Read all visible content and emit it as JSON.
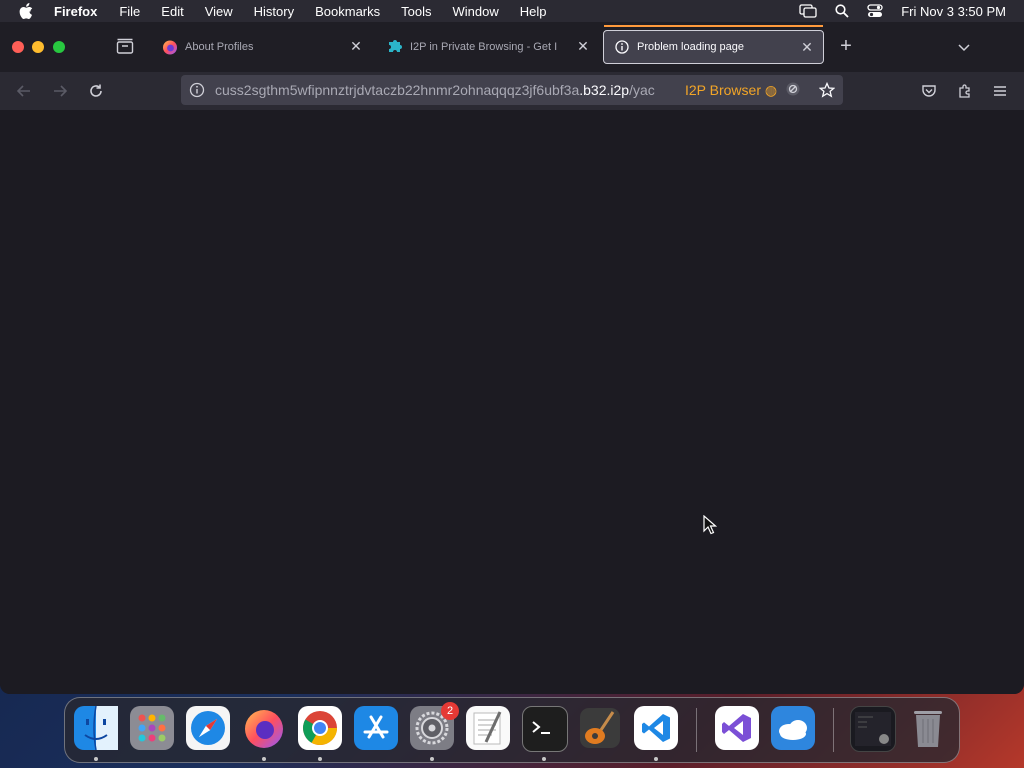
{
  "menubar": {
    "app_name": "Firefox",
    "items": [
      "File",
      "Edit",
      "View",
      "History",
      "Bookmarks",
      "Tools",
      "Window",
      "Help"
    ],
    "clock": "Fri Nov 3  3:50 PM"
  },
  "tabs": [
    {
      "label": "About Profiles",
      "icon": "firefox-icon",
      "active": false
    },
    {
      "label": "I2P in Private Browsing - Get I",
      "icon": "i2p-puzzle-icon",
      "active": false
    },
    {
      "label": "Problem loading page",
      "icon": "info-icon",
      "active": true
    }
  ],
  "urlbar": {
    "url_prefix": "cuss2sgthm5wfipnnztrjdvtaczb22hnmr2ohnaqqqz3jf6ubf3a",
    "url_host": ".b32.i2p",
    "url_suffix": "/yac",
    "badge": "I2P Browser"
  },
  "dock": {
    "apps": [
      "Finder",
      "Launchpad",
      "Safari",
      "Firefox",
      "Google Chrome",
      "App Store",
      "System Settings",
      "TextEdit",
      "Terminal",
      "GarageBand",
      "Visual Studio Code",
      "Visual Studio",
      "Weather",
      "Screenshot",
      "Trash"
    ],
    "settings_badge": "2"
  },
  "colors": {
    "accent_orange": "#ff9a3c",
    "i2p_badge": "#f2a527",
    "window_bg": "#1c1b22"
  }
}
